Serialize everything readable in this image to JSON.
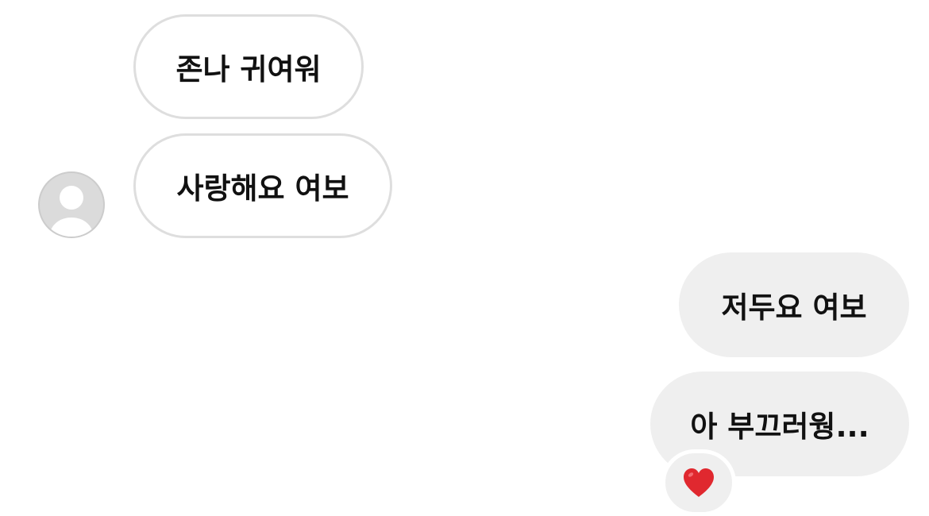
{
  "messages": [
    {
      "direction": "received",
      "text": "존나 귀여워"
    },
    {
      "direction": "received",
      "text": "사랑해요 여보"
    },
    {
      "direction": "sent",
      "text": "저두요 여보"
    },
    {
      "direction": "sent",
      "text": "아 부끄러웡..."
    }
  ],
  "reaction": {
    "emoji": "heart",
    "color": "#e0282f"
  },
  "avatar": {
    "icon": "default-user-avatar",
    "color": "#dbdbdb"
  },
  "colors": {
    "received_border": "#dedede",
    "sent_background": "#efefef",
    "text": "#111111"
  }
}
